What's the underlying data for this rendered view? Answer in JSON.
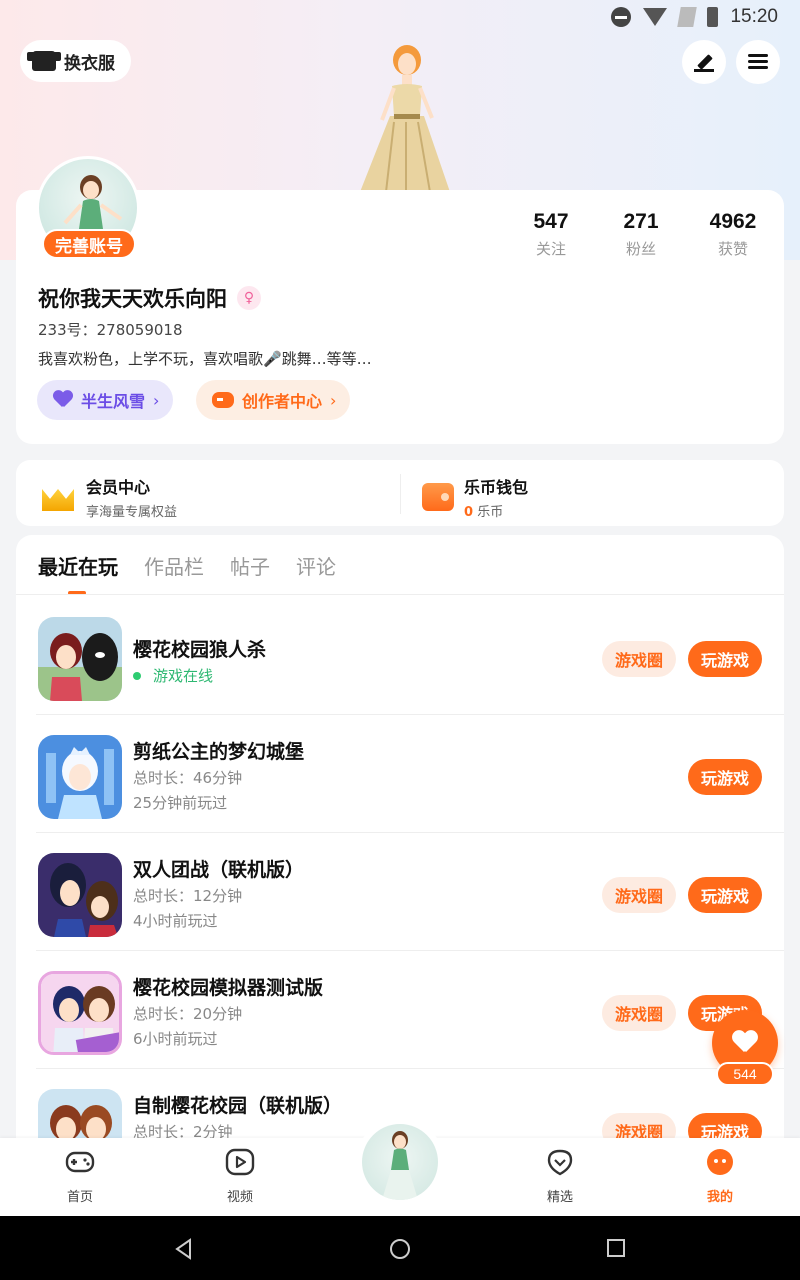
{
  "status_bar": {
    "time": "15:20"
  },
  "header": {
    "dress_up_label": "换衣服"
  },
  "profile": {
    "complete_badge": "完善账号",
    "stats": [
      {
        "value": "547",
        "label": "关注"
      },
      {
        "value": "271",
        "label": "粉丝"
      },
      {
        "value": "4962",
        "label": "获赞"
      }
    ],
    "username": "祝你我天天欢乐向阳",
    "gender_symbol": "♀",
    "uid": "233号：278059018",
    "bio": "我喜欢粉色，上学不玩，喜欢唱歌🎤跳舞…等等…",
    "tags": [
      {
        "label": "半生风雪",
        "chevron": "›"
      },
      {
        "label": "创作者中心",
        "chevron": "›"
      }
    ]
  },
  "vip": {
    "member_title": "会员中心",
    "member_sub": "享海量专属权益",
    "wallet_title": "乐币钱包",
    "wallet_amount": "0",
    "wallet_unit": "乐币"
  },
  "tabs": [
    "最近在玩",
    "作品栏",
    "帖子",
    "评论"
  ],
  "buttons": {
    "circle": "游戏圈",
    "play": "玩游戏"
  },
  "games": [
    {
      "title": "樱花校园狼人杀",
      "status": "游戏在线"
    },
    {
      "title": "剪纸公主的梦幻城堡",
      "duration": "总时长：46分钟",
      "last_played": "25分钟前玩过"
    },
    {
      "title": "双人团战（联机版）",
      "duration": "总时长：12分钟",
      "last_played": "4小时前玩过"
    },
    {
      "title": "樱花校园模拟器测试版",
      "duration": "总时长：20分钟",
      "last_played": "6小时前玩过"
    },
    {
      "title": "自制樱花校园（联机版）",
      "duration": "总时长：2分钟"
    }
  ],
  "fab": {
    "count": "544"
  },
  "bottom_nav": [
    "首页",
    "视频",
    "精选",
    "我的"
  ],
  "colors": {
    "accent": "#ff6a1a",
    "purple": "#6b4de6",
    "online": "#2eb872"
  }
}
